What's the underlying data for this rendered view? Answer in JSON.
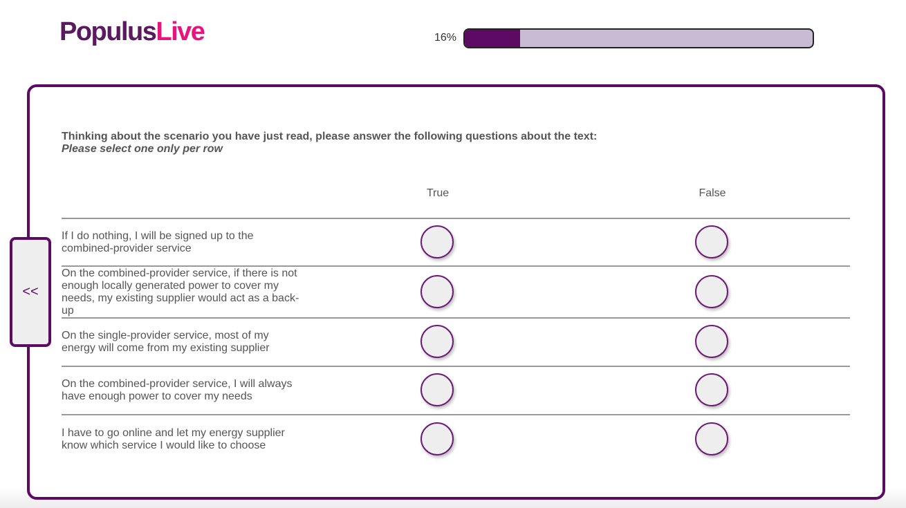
{
  "brand": {
    "logo_part1": "Populus",
    "logo_part2": "Live",
    "primary_color": "#5c0a63",
    "accent_color": "#e6147d"
  },
  "progress": {
    "label": "16%",
    "value": 0.16
  },
  "navigation": {
    "back_label": "<<"
  },
  "survey": {
    "question": "Thinking about the scenario you have just read, please answer the following questions about the text:",
    "instruction": "Please select one only per row",
    "columns": [
      "True",
      "False"
    ],
    "rows": [
      {
        "statement": "If I do nothing, I will be signed up to the combined-provider service",
        "selected": null
      },
      {
        "statement": "On the combined-provider service, if there is not enough locally generated power to cover my needs, my existing supplier would act as a back-up",
        "selected": null
      },
      {
        "statement": "On the single-provider service, most of my energy will come from my existing supplier",
        "selected": null
      },
      {
        "statement": "On the combined-provider service, I will always have enough power to cover my needs",
        "selected": null
      },
      {
        "statement": "I have to go online and let my energy supplier know which service I would like to choose",
        "selected": null
      }
    ]
  }
}
